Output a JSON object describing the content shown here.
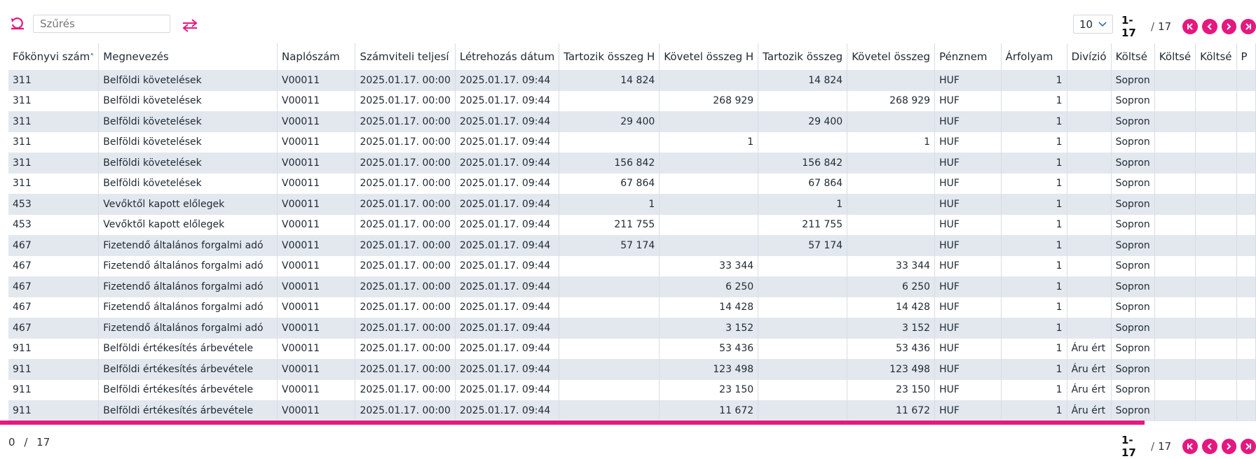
{
  "toolbar": {
    "filter_placeholder": "Szűrés",
    "page_size": "10"
  },
  "pager": {
    "range": "1-17",
    "separator": "/",
    "total": "17"
  },
  "footer": {
    "selected": "0",
    "separator": "/",
    "total": "17"
  },
  "colors": {
    "accent": "#e6177f",
    "row_stripe": "#e3e8ef"
  },
  "table": {
    "columns": [
      {
        "key": "fokonyvi",
        "label": "Főkönyvi szám"
      },
      {
        "key": "megnevezes",
        "label": "Megnevezés"
      },
      {
        "key": "naploszam",
        "label": "Naplószám"
      },
      {
        "key": "szamviteli",
        "label": "Számviteli teljesí"
      },
      {
        "key": "letrehozas",
        "label": "Létrehozás dátum"
      },
      {
        "key": "tartozik_h",
        "label": "Tartozik összeg H"
      },
      {
        "key": "kovetel_h",
        "label": "Követel összeg H"
      },
      {
        "key": "tartozik",
        "label": "Tartozik összeg"
      },
      {
        "key": "kovetel",
        "label": "Követel összeg"
      },
      {
        "key": "penznem",
        "label": "Pénznem"
      },
      {
        "key": "arfolyam",
        "label": "Árfolyam"
      },
      {
        "key": "divizio",
        "label": "Divízió"
      },
      {
        "key": "koltseg1",
        "label": "Költsé"
      },
      {
        "key": "koltseg2",
        "label": "Költsé"
      },
      {
        "key": "koltseg3",
        "label": "Költsé"
      },
      {
        "key": "p",
        "label": "P"
      }
    ],
    "rows": [
      [
        "311",
        "Belföldi követelések",
        "V00011",
        "2025.01.17. 00:00",
        "2025.01.17. 09:44",
        "14 824",
        "",
        "14 824",
        "",
        "HUF",
        "1",
        "",
        "Sopron",
        "",
        "",
        ""
      ],
      [
        "311",
        "Belföldi követelések",
        "V00011",
        "2025.01.17. 00:00",
        "2025.01.17. 09:44",
        "",
        "268 929",
        "",
        "268 929",
        "HUF",
        "1",
        "",
        "Sopron",
        "",
        "",
        ""
      ],
      [
        "311",
        "Belföldi követelések",
        "V00011",
        "2025.01.17. 00:00",
        "2025.01.17. 09:44",
        "29 400",
        "",
        "29 400",
        "",
        "HUF",
        "1",
        "",
        "Sopron",
        "",
        "",
        ""
      ],
      [
        "311",
        "Belföldi követelések",
        "V00011",
        "2025.01.17. 00:00",
        "2025.01.17. 09:44",
        "",
        "1",
        "",
        "1",
        "HUF",
        "1",
        "",
        "Sopron",
        "",
        "",
        ""
      ],
      [
        "311",
        "Belföldi követelések",
        "V00011",
        "2025.01.17. 00:00",
        "2025.01.17. 09:44",
        "156 842",
        "",
        "156 842",
        "",
        "HUF",
        "1",
        "",
        "Sopron",
        "",
        "",
        ""
      ],
      [
        "311",
        "Belföldi követelések",
        "V00011",
        "2025.01.17. 00:00",
        "2025.01.17. 09:44",
        "67 864",
        "",
        "67 864",
        "",
        "HUF",
        "1",
        "",
        "Sopron",
        "",
        "",
        ""
      ],
      [
        "453",
        "Vevőktől kapott előlegek",
        "V00011",
        "2025.01.17. 00:00",
        "2025.01.17. 09:44",
        "1",
        "",
        "1",
        "",
        "HUF",
        "1",
        "",
        "Sopron",
        "",
        "",
        ""
      ],
      [
        "453",
        "Vevőktől kapott előlegek",
        "V00011",
        "2025.01.17. 00:00",
        "2025.01.17. 09:44",
        "211 755",
        "",
        "211 755",
        "",
        "HUF",
        "1",
        "",
        "Sopron",
        "",
        "",
        ""
      ],
      [
        "467",
        "Fizetendő általános forgalmi adó",
        "V00011",
        "2025.01.17. 00:00",
        "2025.01.17. 09:44",
        "57 174",
        "",
        "57 174",
        "",
        "HUF",
        "1",
        "",
        "Sopron",
        "",
        "",
        ""
      ],
      [
        "467",
        "Fizetendő általános forgalmi adó",
        "V00011",
        "2025.01.17. 00:00",
        "2025.01.17. 09:44",
        "",
        "33 344",
        "",
        "33 344",
        "HUF",
        "1",
        "",
        "Sopron",
        "",
        "",
        ""
      ],
      [
        "467",
        "Fizetendő általános forgalmi adó",
        "V00011",
        "2025.01.17. 00:00",
        "2025.01.17. 09:44",
        "",
        "6 250",
        "",
        "6 250",
        "HUF",
        "1",
        "",
        "Sopron",
        "",
        "",
        ""
      ],
      [
        "467",
        "Fizetendő általános forgalmi adó",
        "V00011",
        "2025.01.17. 00:00",
        "2025.01.17. 09:44",
        "",
        "14 428",
        "",
        "14 428",
        "HUF",
        "1",
        "",
        "Sopron",
        "",
        "",
        ""
      ],
      [
        "467",
        "Fizetendő általános forgalmi adó",
        "V00011",
        "2025.01.17. 00:00",
        "2025.01.17. 09:44",
        "",
        "3 152",
        "",
        "3 152",
        "HUF",
        "1",
        "",
        "Sopron",
        "",
        "",
        ""
      ],
      [
        "911",
        "Belföldi értékesítés árbevétele",
        "V00011",
        "2025.01.17. 00:00",
        "2025.01.17. 09:44",
        "",
        "53 436",
        "",
        "53 436",
        "HUF",
        "1",
        "Áru ért",
        "Sopron",
        "",
        "",
        ""
      ],
      [
        "911",
        "Belföldi értékesítés árbevétele",
        "V00011",
        "2025.01.17. 00:00",
        "2025.01.17. 09:44",
        "",
        "123 498",
        "",
        "123 498",
        "HUF",
        "1",
        "Áru ért",
        "Sopron",
        "",
        "",
        ""
      ],
      [
        "911",
        "Belföldi értékesítés árbevétele",
        "V00011",
        "2025.01.17. 00:00",
        "2025.01.17. 09:44",
        "",
        "23 150",
        "",
        "23 150",
        "HUF",
        "1",
        "Áru ért",
        "Sopron",
        "",
        "",
        ""
      ],
      [
        "911",
        "Belföldi értékesítés árbevétele",
        "V00011",
        "2025.01.17. 00:00",
        "2025.01.17. 09:44",
        "",
        "11 672",
        "",
        "11 672",
        "HUF",
        "1",
        "Áru ért",
        "Sopron",
        "",
        "",
        ""
      ]
    ]
  }
}
